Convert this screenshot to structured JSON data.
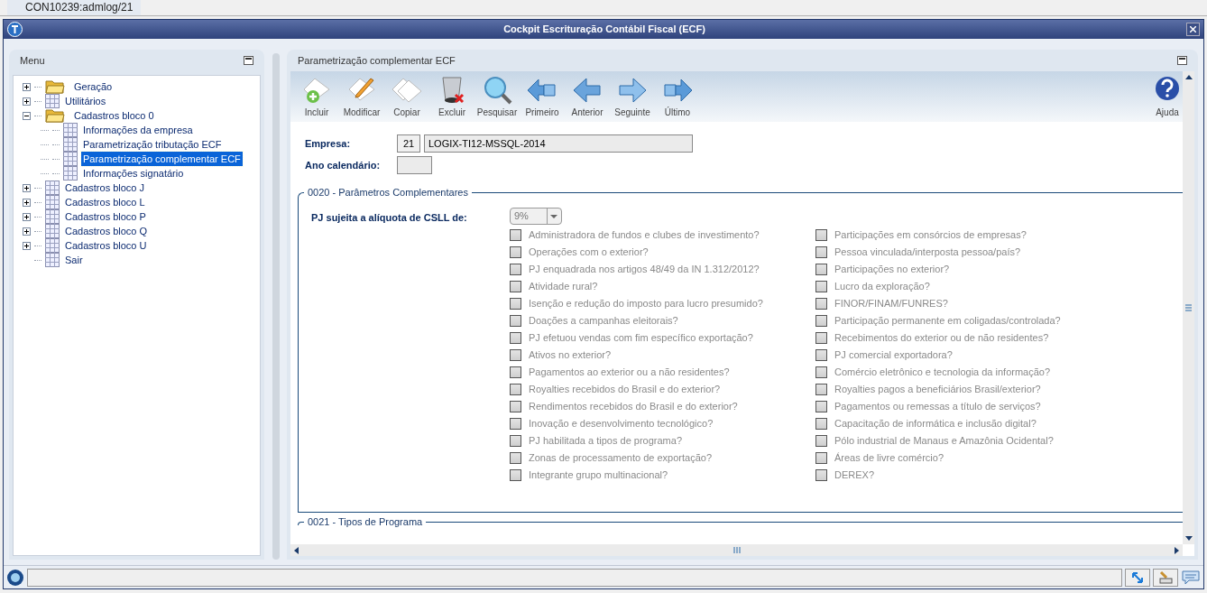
{
  "tab": {
    "label": "CON10239:admlog/21"
  },
  "window": {
    "title": "Cockpit Escrituração Contábil Fiscal (ECF)"
  },
  "menu": {
    "title": "Menu",
    "items": [
      {
        "label": "Geração",
        "kind": "folder",
        "expanded": false,
        "selected": false
      },
      {
        "label": "Utilitários",
        "kind": "table",
        "expanded": false,
        "selected": false
      },
      {
        "label": "Cadastros bloco 0",
        "kind": "folder",
        "expanded": true,
        "selected": false,
        "children": [
          {
            "label": "Informações da empresa",
            "kind": "table",
            "selected": false
          },
          {
            "label": "Parametrização tributação ECF",
            "kind": "table",
            "selected": false
          },
          {
            "label": "Parametrização complementar ECF",
            "kind": "table",
            "selected": true
          },
          {
            "label": "Informações signatário",
            "kind": "table",
            "selected": false
          }
        ]
      },
      {
        "label": "Cadastros bloco J",
        "kind": "table",
        "expanded": false,
        "selected": false
      },
      {
        "label": "Cadastros bloco L",
        "kind": "table",
        "expanded": false,
        "selected": false
      },
      {
        "label": "Cadastros bloco P",
        "kind": "table",
        "expanded": false,
        "selected": false
      },
      {
        "label": "Cadastros bloco Q",
        "kind": "table",
        "expanded": false,
        "selected": false
      },
      {
        "label": "Cadastros bloco U",
        "kind": "table",
        "expanded": false,
        "selected": false
      },
      {
        "label": "Sair",
        "kind": "table",
        "selected": false
      }
    ]
  },
  "panel": {
    "title": "Parametrização complementar ECF",
    "toolbar": [
      {
        "label": "Incluir",
        "kind": "add"
      },
      {
        "label": "Modificar",
        "kind": "edit"
      },
      {
        "label": "Copiar",
        "kind": "copy"
      },
      {
        "label": "Excluir",
        "kind": "delete"
      },
      {
        "label": "Pesquisar",
        "kind": "search"
      },
      {
        "label": "Primeiro",
        "kind": "first"
      },
      {
        "label": "Anterior",
        "kind": "previous"
      },
      {
        "label": "Seguinte",
        "kind": "next"
      },
      {
        "label": "Último",
        "kind": "last"
      }
    ],
    "help": {
      "label": "Ajuda"
    },
    "empresa": {
      "label": "Empresa:",
      "code": "21",
      "name": "LOGIX-TI12-MSSQL-2014"
    },
    "ano": {
      "label": "Ano calendário:"
    },
    "section": {
      "title": "0020 - Parâmetros Complementares",
      "csll": {
        "label": "PJ sujeita a alíquota de CSLL de:",
        "value": "9%"
      },
      "column_1": [
        {
          "label": "Administradora de fundos e clubes de investimento?",
          "checked": false,
          "disabled": true
        },
        {
          "label": "Operações com o exterior?",
          "checked": false,
          "disabled": true
        },
        {
          "label": "PJ enquadrada nos artigos 48/49 da IN 1.312/2012?",
          "checked": false,
          "disabled": true
        },
        {
          "label": "Atividade rural?",
          "checked": false,
          "disabled": true
        },
        {
          "label": "Isenção e redução do imposto para lucro presumido?",
          "checked": false,
          "disabled": true
        },
        {
          "label": "Doações a campanhas eleitorais?",
          "checked": false,
          "disabled": true
        },
        {
          "label": "PJ efetuou vendas com fim específico exportação?",
          "checked": false,
          "disabled": true
        },
        {
          "label": "Ativos no exterior?",
          "checked": false,
          "disabled": true
        },
        {
          "label": "Pagamentos ao exterior ou a não residentes?",
          "checked": false,
          "disabled": true
        },
        {
          "label": "Royalties recebidos do Brasil e do exterior?",
          "checked": false,
          "disabled": true
        },
        {
          "label": "Rendimentos recebidos do Brasil e do exterior?",
          "checked": false,
          "disabled": true
        },
        {
          "label": "Inovação e desenvolvimento tecnológico?",
          "checked": false,
          "disabled": true
        },
        {
          "label": "PJ habilitada a tipos de programa?",
          "checked": false,
          "disabled": true
        },
        {
          "label": "Zonas de processamento de exportação?",
          "checked": false,
          "disabled": true
        },
        {
          "label": "Integrante grupo multinacional?",
          "checked": false,
          "disabled": true
        }
      ],
      "column_2": [
        {
          "label": "Participações em consórcios de empresas?",
          "checked": false,
          "disabled": true
        },
        {
          "label": "Pessoa vinculada/interposta pessoa/país?",
          "checked": false,
          "disabled": true
        },
        {
          "label": "Participações no exterior?",
          "checked": false,
          "disabled": true
        },
        {
          "label": "Lucro da exploração?",
          "checked": false,
          "disabled": true
        },
        {
          "label": "FINOR/FINAM/FUNRES?",
          "checked": false,
          "disabled": true
        },
        {
          "label": "Participação permanente em coligadas/controlada?",
          "checked": false,
          "disabled": true
        },
        {
          "label": "Recebimentos do exterior ou de não residentes?",
          "checked": false,
          "disabled": true
        },
        {
          "label": "PJ comercial exportadora?",
          "checked": false,
          "disabled": true
        },
        {
          "label": "Comércio eletrônico e tecnologia da informação?",
          "checked": false,
          "disabled": true
        },
        {
          "label": "Royalties pagos a beneficiários Brasil/exterior?",
          "checked": false,
          "disabled": true
        },
        {
          "label": "Pagamentos ou remessas a título de serviços?",
          "checked": false,
          "disabled": true
        },
        {
          "label": "Capacitação de informática e inclusão digital?",
          "checked": false,
          "disabled": true
        },
        {
          "label": "Pólo industrial de Manaus e Amazônia Ocidental?",
          "checked": false,
          "disabled": true
        },
        {
          "label": "Áreas de livre comércio?",
          "checked": false,
          "disabled": true
        },
        {
          "label": "DEREX?",
          "checked": false,
          "disabled": true
        }
      ]
    },
    "next_section": {
      "title": "0021 - Tipos de Programa"
    }
  }
}
